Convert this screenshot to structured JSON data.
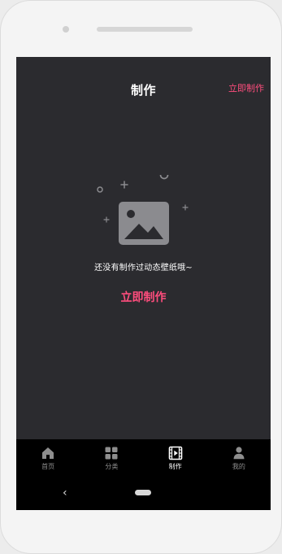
{
  "header": {
    "title": "制作",
    "action_label": "立即制作"
  },
  "empty_state": {
    "message": "还没有制作过动态壁纸哦~",
    "action_label": "立即制作",
    "illustration_icon": "image-placeholder-icon"
  },
  "tabs": [
    {
      "label": "首页",
      "icon": "home-icon",
      "active": false
    },
    {
      "label": "分类",
      "icon": "grid-icon",
      "active": false
    },
    {
      "label": "制作",
      "icon": "video-icon",
      "active": true
    },
    {
      "label": "我的",
      "icon": "user-icon",
      "active": false
    }
  ],
  "system_nav": {
    "back_glyph": "‹"
  },
  "colors": {
    "accent": "#ff4d7d",
    "screen_bg": "#2b2b2f",
    "tab_bg": "#000000",
    "active_text": "#ffffff",
    "inactive_text": "#8e8e8e",
    "illustration": "#8b8b8f"
  }
}
